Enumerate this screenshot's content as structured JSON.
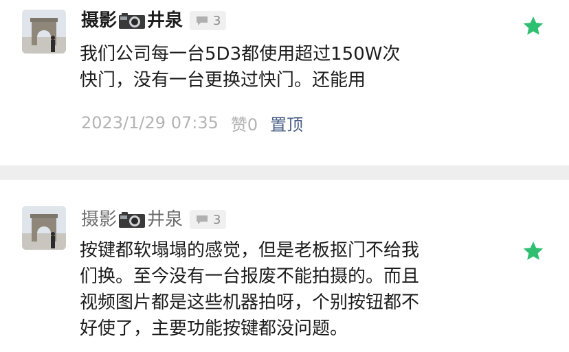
{
  "comments": [
    {
      "author_part1": "摄影",
      "author_part2": "井泉",
      "reply_count": "3",
      "text_lines": [
        "我们公司每一台5D3都使用超过150W次",
        "快门，没有一台更换过快门。还能用"
      ],
      "timestamp": "2023/1/29 07:35",
      "likes_label": "赞",
      "likes_count": "0",
      "pin_label": "置顶",
      "star_color": "#2fbf71"
    },
    {
      "author_part1": "摄影",
      "author_part2": "井泉",
      "reply_count": "3",
      "text_lines": [
        "按键都软塌塌的感觉，但是老板抠门不给我",
        "们换。至今没有一台报废不能拍摄的。而且",
        "视频图片都是这些机器拍呀，个别按钮都不",
        "好使了，主要功能按键都没问题。"
      ],
      "star_color": "#2fbf71"
    }
  ]
}
